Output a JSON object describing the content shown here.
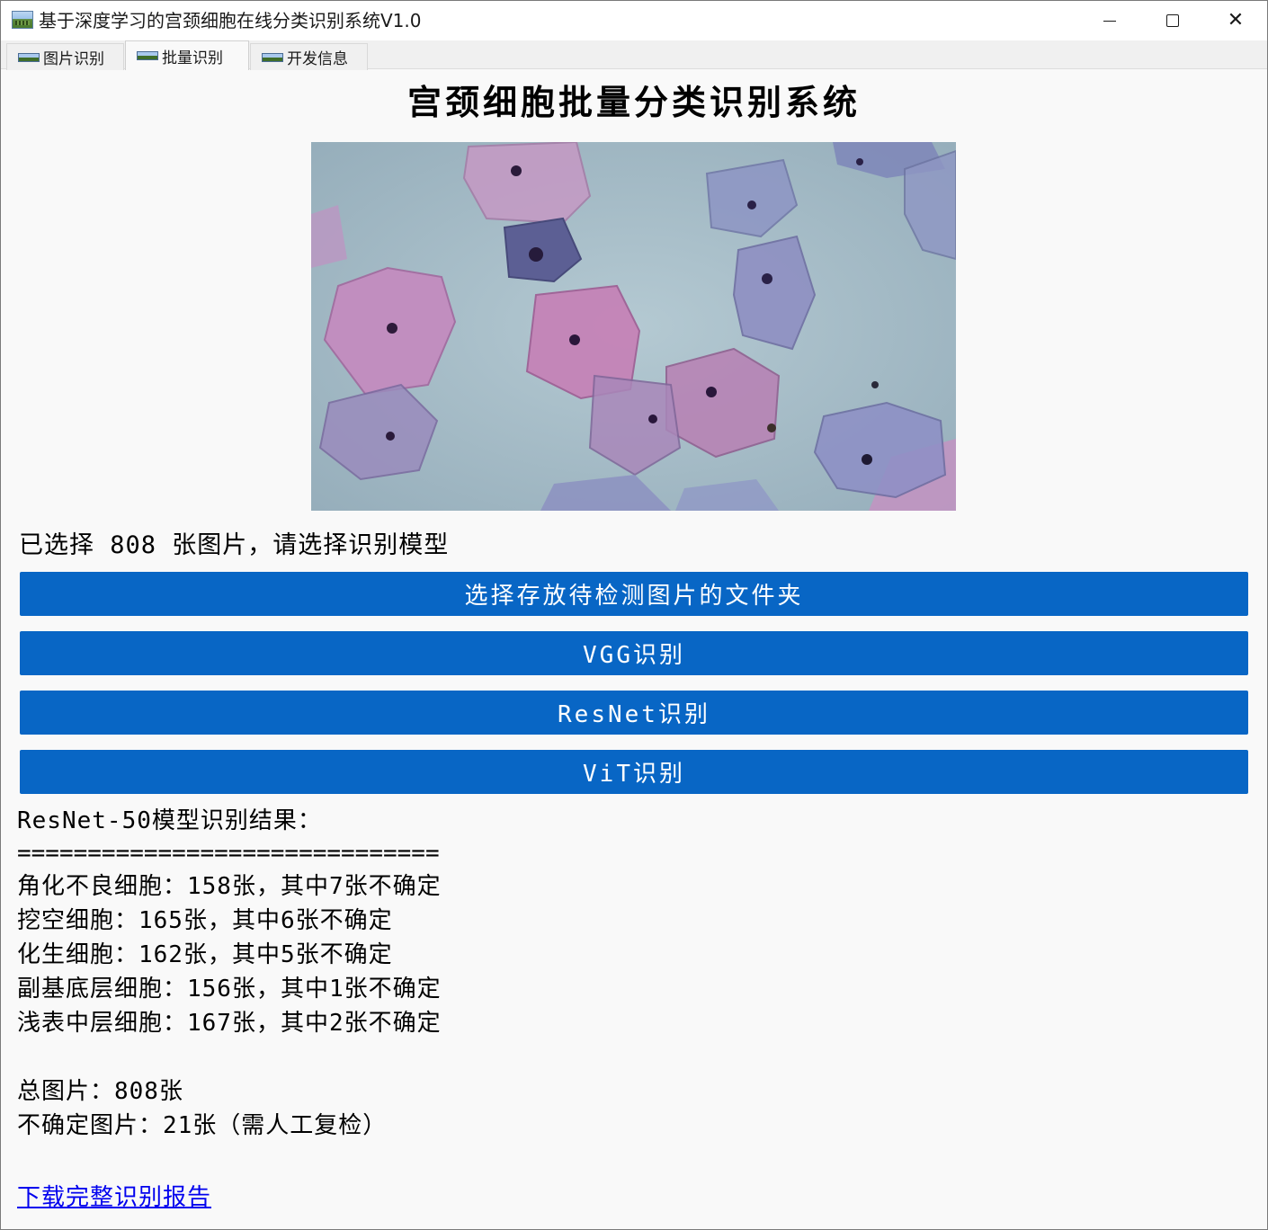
{
  "window": {
    "title": "基于深度学习的宫颈细胞在线分类识别系统V1.0",
    "controls": {
      "minimize_icon": "minimize-icon",
      "maximize_icon": "maximize-icon",
      "close_icon": "close-icon",
      "close_glyph": "✕"
    }
  },
  "tabs": [
    {
      "label": "图片识别",
      "icon": "picture-icon",
      "active": false
    },
    {
      "label": "批量识别",
      "icon": "picture-icon",
      "active": true
    },
    {
      "label": "开发信息",
      "icon": "picture-icon",
      "active": false
    }
  ],
  "main": {
    "heading": "宫颈细胞批量分类识别系统",
    "status": "已选择 808 张图片，请选择识别模型",
    "buttons": {
      "select_folder": "选择存放待检测图片的文件夹",
      "vgg": "VGG识别",
      "resnet": "ResNet识别",
      "vit": "ViT识别"
    },
    "results": {
      "title": "ResNet-50模型识别结果：",
      "separator": "==============================",
      "lines": [
        "角化不良细胞：158张，其中7张不确定",
        "挖空细胞：165张，其中6张不确定",
        "化生细胞：162张，其中5张不确定",
        "副基底层细胞：156张，其中1张不确定",
        "浅表中层细胞：167张，其中2张不确定"
      ],
      "total": "总图片：808张",
      "uncertain": "不确定图片：21张（需人工复检）"
    },
    "download_link": "下载完整识别报告"
  },
  "colors": {
    "accent_button": "#0866c5",
    "link": "#0000ee",
    "background": "#f9f9f9"
  }
}
